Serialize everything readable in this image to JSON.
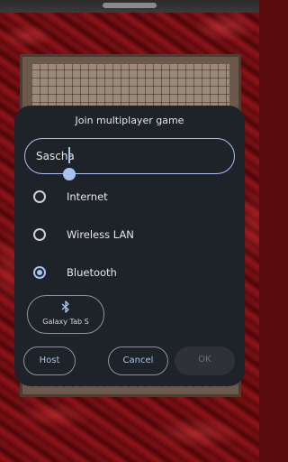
{
  "dialog": {
    "title": "Join multiplayer game",
    "name_value": "Sascha",
    "options": [
      {
        "label": "Internet",
        "selected": false
      },
      {
        "label": "Wireless LAN",
        "selected": false
      },
      {
        "label": "Bluetooth",
        "selected": true
      }
    ],
    "device": {
      "icon": "bluetooth-icon",
      "label": "Galaxy Tab S"
    },
    "buttons": {
      "host": "Host",
      "cancel": "Cancel",
      "ok": "OK"
    }
  },
  "colors": {
    "accent": "#a8c2f0",
    "dialog_bg": "#1e232a",
    "background_fabric": "#7a1015"
  }
}
